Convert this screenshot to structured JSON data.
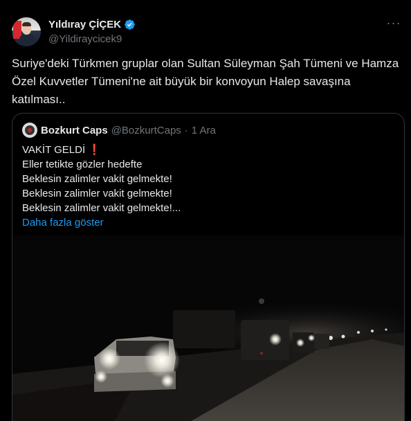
{
  "author": {
    "display_name": "Yıldıray ÇİÇEK",
    "handle": "@Yildiraycicek9"
  },
  "more_icon": "more-horizontal-icon",
  "tweet_text": "Suriye'deki Türkmen gruplar olan Sultan Süleyman Şah Tümeni ve Hamza Özel Kuvvetler Tümeni'ne ait büyük bir konvoyun Halep savaşına katılması..",
  "quote": {
    "display_name": "Bozkurt Caps",
    "handle": "@BozkurtCaps",
    "separator": "·",
    "date": "1 Ara",
    "title": "VAKİT GELDİ",
    "title_emoji": "❗",
    "lines": [
      "Eller tetikte gözler hedefte",
      "Beklesin zalimler vakit gelmekte!",
      "Beklesin zalimler vakit gelmekte!",
      "Beklesin zalimler vakit gelmekte!..."
    ],
    "show_more": "Daha fazla göster"
  },
  "colors": {
    "background": "#000000",
    "text": "#e7e9ea",
    "secondary": "#71767b",
    "link": "#1d9bf0",
    "verified": "#1d9bf0",
    "border": "#2f3336"
  }
}
